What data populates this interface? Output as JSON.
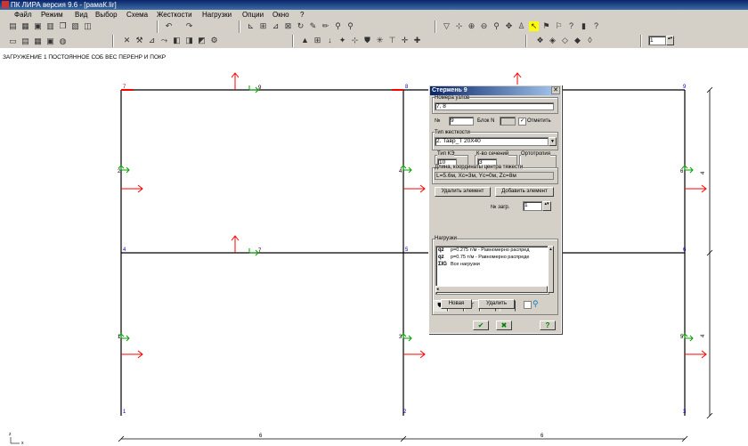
{
  "app": {
    "title": "ПК ЛИРА  версия 9.6 - [рамаК.lir]"
  },
  "menu": [
    "Файл",
    "Режим",
    "Вид",
    "Выбор",
    "Схема",
    "Жесткости",
    "Нагрузки",
    "Опции",
    "Окно",
    "?"
  ],
  "toolbar": {
    "load_number": "1"
  },
  "status": {
    "loading_text": "ЗАГРУЖЕНИЕ 1 ПОСТОЯННОЕ СОБ ВЕС ПЕРЕНР И ПОКР"
  },
  "scheme": {
    "node_labels": [
      "7",
      "8",
      "9",
      "4",
      "5",
      "6",
      "1",
      "2",
      "3"
    ],
    "element_labels": [
      "9",
      "7",
      "2",
      "4",
      "6",
      "1",
      "3",
      "5"
    ],
    "dimensions": {
      "span_left": "6",
      "span_right": "6",
      "height_top": "4",
      "height_bottom": "4"
    },
    "axis_z": "z",
    "axis_x": "x"
  },
  "dialog": {
    "title": "Стержень  9",
    "nodes_label": "Номера узлов",
    "nodes_value": "7, 8",
    "number_label": "№",
    "number_value": "9",
    "block_label": "Блок N",
    "block_value": "",
    "mark_label": "Отметить",
    "stiffness_label": "Тип жесткости",
    "stiffness_value": "2. Тавр_Т 20Х40",
    "fe_type_label": "Тип КЭ",
    "fe_type_value": "10",
    "sections_label": "К-во сечений",
    "sections_value": "3",
    "ortho_label": "Ортотропия",
    "length_label": "Длина, координаты центра тяжести",
    "length_value": "L=5.6м, Xc=3м, Yc=0м, Zc=8м",
    "delete_element": "Удалить элемент",
    "add_element": "Добавить элемент",
    "load_no_label": "№ загр.",
    "load_no_value": "1",
    "tab_c1": "С1",
    "loads_label": "Нагрузки",
    "loads": [
      {
        "icon": "qz",
        "text": "р=0.275 т/м - Равномерно распред"
      },
      {
        "icon": "qz",
        "text": "р=0.75 т/м - Равномерно распреде"
      },
      {
        "icon": "ΣIG",
        "text": "Все нагрузки"
      }
    ],
    "new_button": "Новая",
    "delete_button": "Удалить"
  },
  "colors": {
    "load_arrow": "#ff0000",
    "local_axis": "#00a000",
    "node_label": "#0000c0",
    "frame": "#000000",
    "title_bar": "#0a246a"
  }
}
